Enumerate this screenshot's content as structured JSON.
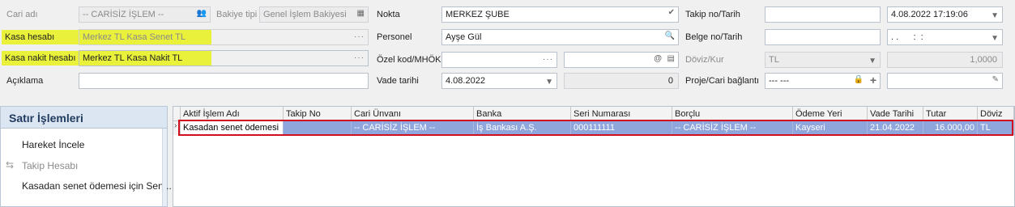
{
  "form": {
    "cari_adi_label": "Cari adı",
    "cari_adi_value": "-- CARİSİZ İŞLEM --",
    "bakiye_tipi_label": "Bakiye tipi",
    "bakiye_tipi_value": "Genel İşlem Bakiyesi",
    "kasa_hesabi_label": "Kasa hesabı",
    "kasa_hesabi_value": "Merkez TL Kasa Senet TL",
    "kasa_nakit_label": "Kasa nakit hesabı",
    "kasa_nakit_value": "Merkez TL Kasa Nakit TL",
    "aciklama_label": "Açıklama",
    "aciklama_value": "",
    "nokta_label": "Nokta",
    "nokta_value": "MERKEZ ŞUBE",
    "personel_label": "Personel",
    "personel_value": "Ayşe Gül",
    "ozel_kod_label": "Özel kod/MHÖK",
    "ozel_kod_value": "",
    "ozel_kod2_value": "",
    "vade_label": "Vade tarihi",
    "vade_value": "4.08.2022",
    "vade_days": "0",
    "takip_label": "Takip no/Tarih",
    "takip_no_value": "",
    "takip_tarih_value": "4.08.2022 17:19:06",
    "belge_label": "Belge no/Tarih",
    "belge_no_value": "",
    "belge_tarih_value": ". .      :  :",
    "doviz_label": "Döviz/Kur",
    "doviz_value": "TL",
    "kur_value": "1,0000",
    "proje_label": "Proje/Cari bağlantı",
    "proje_value": "--- ---",
    "cari_baglanti_value": ""
  },
  "sidebar": {
    "title": "Satır İşlemleri",
    "items": [
      {
        "label": "Hareket İncele"
      },
      {
        "label": "Takip Hesabı"
      },
      {
        "label": "Kasadan senet ödemesi için Sen..."
      }
    ]
  },
  "grid": {
    "columns": [
      "Aktif İşlem Adı",
      "Takip No",
      "Cari Ünvanı",
      "Banka",
      "Seri Numarası",
      "Borçlu",
      "Ödeme Yeri",
      "Vade Tarihi",
      "Tutar",
      "Döviz"
    ],
    "rows": [
      [
        "Kasadan senet ödemesi",
        "",
        "-- CARİSİZ İŞLEM --",
        "İş Bankası A.Ş.",
        "000111111",
        "-- CARİSİZ İŞLEM --",
        "Kayseri",
        "21.04.2022",
        "16.000,00",
        "TL"
      ]
    ]
  },
  "colors": {
    "highlight": "#e9f13a",
    "selected_row": "#8fa6dc",
    "red_outline": "#d0101e",
    "panel_head": "#dce6f2"
  }
}
